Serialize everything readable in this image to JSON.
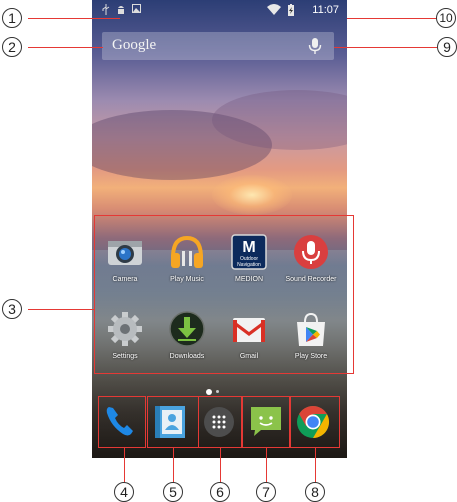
{
  "status_bar": {
    "time": "11:07",
    "left_icons": [
      "usb-icon",
      "android-debug-icon",
      "image-icon"
    ],
    "right_icons": [
      "wifi-icon",
      "battery-charging-icon"
    ]
  },
  "search": {
    "label": "Google",
    "mic_icon": "microphone-icon"
  },
  "apps": [
    {
      "label": "Camera",
      "icon": "camera-icon"
    },
    {
      "label": "Play Music",
      "icon": "headphones-icon"
    },
    {
      "label": "MEDION",
      "icon": "medion-navigation-icon",
      "badge_letter": "M",
      "badge_line1": "Outdoor",
      "badge_line2": "Navigation"
    },
    {
      "label": "Sound Recorder",
      "icon": "microphone-icon"
    },
    {
      "label": "Settings",
      "icon": "gear-icon"
    },
    {
      "label": "Downloads",
      "icon": "download-icon"
    },
    {
      "label": "Gmail",
      "icon": "gmail-icon"
    },
    {
      "label": "Play Store",
      "icon": "play-store-icon"
    }
  ],
  "dock": [
    {
      "icon": "phone-icon"
    },
    {
      "icon": "contacts-icon"
    },
    {
      "icon": "app-drawer-icon"
    },
    {
      "icon": "messaging-icon"
    },
    {
      "icon": "chrome-icon"
    }
  ],
  "page_indicator": {
    "pages": 2,
    "current": 1
  },
  "callouts": [
    "1",
    "2",
    "3",
    "4",
    "5",
    "6",
    "7",
    "8",
    "9",
    "10"
  ],
  "colors": {
    "callout_line": "#e53935",
    "chrome_red": "#db4437",
    "chrome_green": "#0f9d58",
    "chrome_yellow": "#f4b400",
    "chrome_blue": "#4285f4"
  }
}
